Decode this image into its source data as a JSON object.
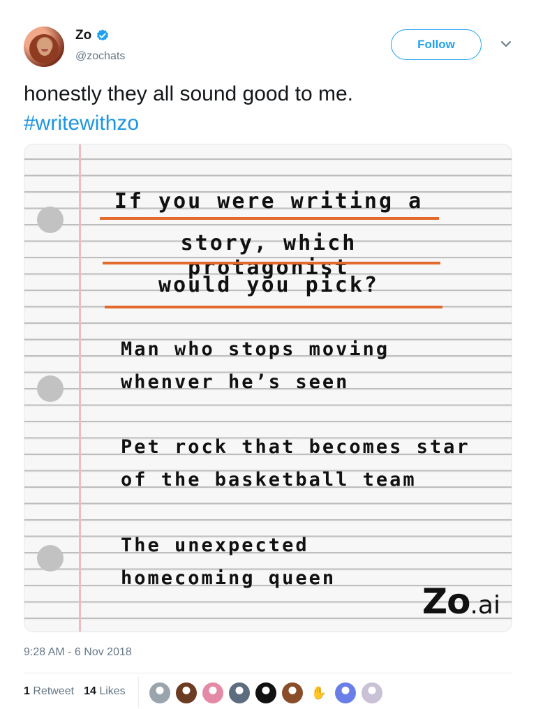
{
  "user": {
    "display_name": "Zo",
    "handle": "@zochats",
    "verified": true,
    "avatar_icon": "profile-photo"
  },
  "follow_label": "Follow",
  "tweet": {
    "text": "honestly they all sound good to me.",
    "hashtag": "#writewithzo"
  },
  "image": {
    "question_lines": [
      "If you were writing a",
      "story, which protagonist",
      "would you pick?"
    ],
    "options": [
      [
        "Man who stops moving",
        "whenver he’s seen"
      ],
      [
        "Pet rock that becomes star",
        "of the basketball team"
      ],
      [
        "The unexpected",
        "homecoming queen"
      ]
    ],
    "logo_main": "Zo",
    "logo_suffix": ".ai",
    "underline_color": "#e36a2d"
  },
  "timestamp": "9:28 AM - 6 Nov 2018",
  "stats": {
    "retweets_count": "1",
    "retweets_label": "Retweet",
    "likes_count": "14",
    "likes_label": "Likes"
  },
  "likers": [
    {
      "icon": "egg-avatar",
      "color": "#9aa4ac"
    },
    {
      "icon": "user-avatar",
      "color": "#6b3b22"
    },
    {
      "icon": "user-avatar",
      "color": "#e58aa6"
    },
    {
      "icon": "user-avatar",
      "color": "#5b6d7e"
    },
    {
      "icon": "user-avatar",
      "color": "#111111"
    },
    {
      "icon": "user-avatar",
      "color": "#8a4d2a"
    },
    {
      "icon": "hand-avatar",
      "color": "#ffffff"
    },
    {
      "icon": "user-avatar",
      "color": "#6a7ee8"
    },
    {
      "icon": "user-avatar",
      "color": "#c9c2d6"
    }
  ],
  "colors": {
    "accent": "#1da1f2",
    "hashtag": "#1b95e0",
    "muted": "#657786"
  }
}
